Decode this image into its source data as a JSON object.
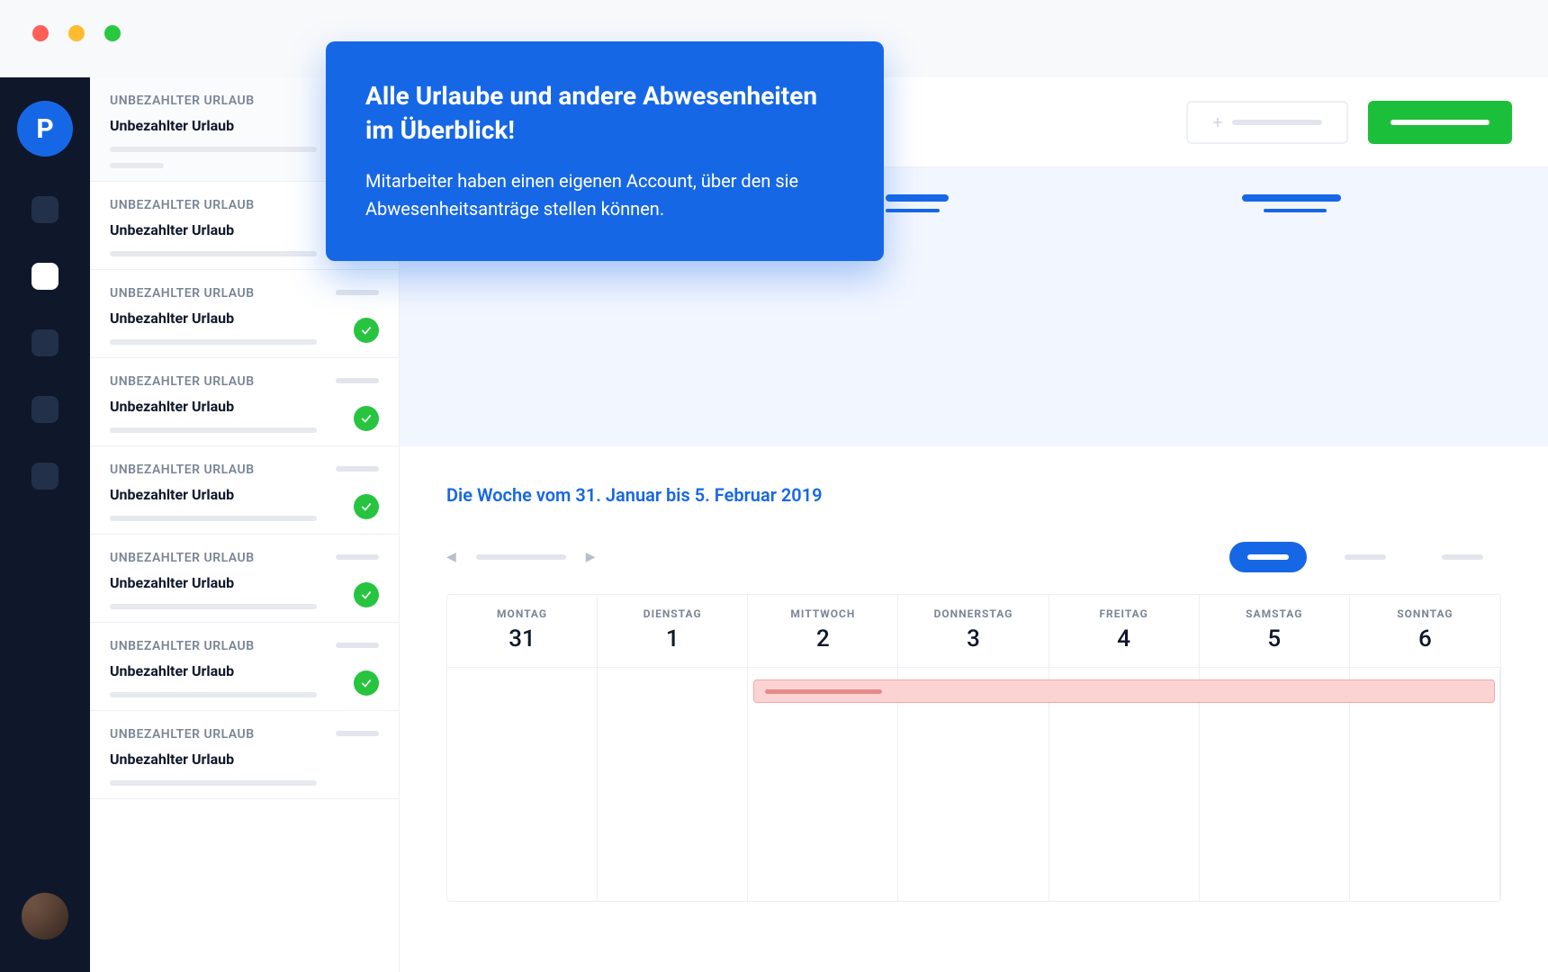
{
  "window": {
    "traffic": [
      "red",
      "yellow",
      "green"
    ]
  },
  "rail": {
    "logo_letter": "P",
    "items": [
      {
        "active": false
      },
      {
        "active": true
      },
      {
        "active": false
      },
      {
        "active": false
      },
      {
        "active": false
      }
    ]
  },
  "sidebar": {
    "items": [
      {
        "category": "UNBEZAHLTER URLAUB",
        "title": "Unbezahlter Urlaub",
        "approved": false
      },
      {
        "category": "UNBEZAHLTER URLAUB",
        "title": "Unbezahlter Urlaub",
        "approved": true
      },
      {
        "category": "UNBEZAHLTER URLAUB",
        "title": "Unbezahlter Urlaub",
        "approved": true
      },
      {
        "category": "UNBEZAHLTER URLAUB",
        "title": "Unbezahlter Urlaub",
        "approved": true
      },
      {
        "category": "UNBEZAHLTER URLAUB",
        "title": "Unbezahlter Urlaub",
        "approved": true
      },
      {
        "category": "UNBEZAHLTER URLAUB",
        "title": "Unbezahlter Urlaub",
        "approved": true
      },
      {
        "category": "UNBEZAHLTER URLAUB",
        "title": "Unbezahlter Urlaub",
        "approved": true
      },
      {
        "category": "UNBEZAHLTER URLAUB",
        "title": "Unbezahlter Urlaub",
        "approved": true
      }
    ]
  },
  "callout": {
    "heading": "Alle Urlaube und andere Abwesenheiten im Überblick!",
    "body": "Mitarbeiter haben einen eigenen Account, über den sie Abwesenheitsanträge stellen können."
  },
  "actions": {
    "add_icon": "+",
    "primary_color": "#1bbf3a"
  },
  "calendar": {
    "title": "Die Woche vom 31. Januar bis 5. Februar 2019",
    "nav_prev_icon": "◀",
    "nav_next_icon": "▶",
    "days": [
      {
        "dow": "MONTAG",
        "num": "31"
      },
      {
        "dow": "DIENSTAG",
        "num": "1"
      },
      {
        "dow": "MITTWOCH",
        "num": "2"
      },
      {
        "dow": "DONNERSTAG",
        "num": "3"
      },
      {
        "dow": "FREITAG",
        "num": "4"
      },
      {
        "dow": "SAMSTAG",
        "num": "5"
      },
      {
        "dow": "SONNTAG",
        "num": "6"
      }
    ],
    "event": {
      "start_day_index": 2,
      "end_day_index": 6,
      "color": "#fbd3d3"
    }
  }
}
